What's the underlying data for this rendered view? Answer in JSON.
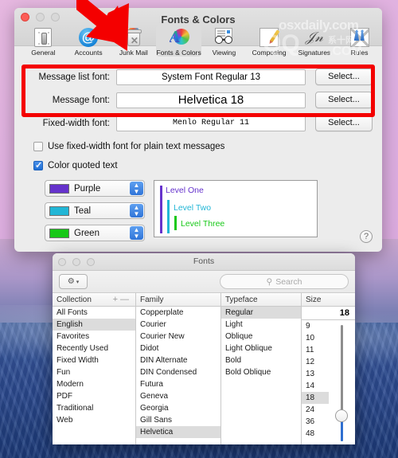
{
  "prefs_window": {
    "title": "Fonts & Colors",
    "traffic_lights": [
      "close",
      "minimize",
      "maximize"
    ],
    "toolbar": [
      {
        "label": "General",
        "icon": "general-icon",
        "selected": false
      },
      {
        "label": "Accounts",
        "icon": "accounts-at-icon",
        "selected": false
      },
      {
        "label": "Junk Mail",
        "icon": "junk-mail-trash-icon",
        "selected": false
      },
      {
        "label": "Fonts & Colors",
        "icon": "fonts-colors-icon",
        "selected": true
      },
      {
        "label": "Viewing",
        "icon": "viewing-glasses-icon",
        "selected": false
      },
      {
        "label": "Composing",
        "icon": "composing-pencil-icon",
        "selected": false
      },
      {
        "label": "Signatures",
        "icon": "signature-icon",
        "selected": false
      },
      {
        "label": "Rules",
        "icon": "rules-arrows-icon",
        "selected": false
      }
    ],
    "rows": [
      {
        "label": "Message list font:",
        "value": "System Font Regular 13",
        "button": "Select..."
      },
      {
        "label": "Message font:",
        "value": "Helvetica 18",
        "button": "Select..."
      },
      {
        "label": "Fixed-width font:",
        "value": "Menlo Regular 11",
        "button": "Select..."
      }
    ],
    "checkboxes": [
      {
        "label": "Use fixed-width font for plain text messages",
        "checked": false
      },
      {
        "label": "Color quoted text",
        "checked": true
      }
    ],
    "quote_colors": [
      {
        "name": "Purple",
        "hex": "#6633cc"
      },
      {
        "name": "Teal",
        "hex": "#22b6d6"
      },
      {
        "name": "Green",
        "hex": "#18c818"
      }
    ],
    "preview_levels": [
      {
        "label": "Level One",
        "hex": "#6633cc"
      },
      {
        "label": "Level Two",
        "hex": "#22b6d6"
      },
      {
        "label": "Level Three",
        "hex": "#18c818"
      }
    ],
    "help_label": "?"
  },
  "fonts_panel": {
    "title": "Fonts",
    "gear_label": "gear",
    "search_placeholder": "Search",
    "columns": {
      "collection": {
        "header": "Collection",
        "add_label": "+",
        "remove_label": "—",
        "items": [
          "All Fonts",
          "English",
          "Favorites",
          "Recently Used",
          "Fixed Width",
          "Fun",
          "Modern",
          "PDF",
          "Traditional",
          "Web"
        ],
        "selected": "English"
      },
      "family": {
        "header": "Family",
        "items": [
          "Copperplate",
          "Courier",
          "Courier New",
          "Didot",
          "DIN Alternate",
          "DIN Condensed",
          "Futura",
          "Geneva",
          "Georgia",
          "Gill Sans",
          "Helvetica"
        ],
        "selected": "Helvetica"
      },
      "typeface": {
        "header": "Typeface",
        "items": [
          "Regular",
          "Light",
          "Oblique",
          "Light Oblique",
          "Bold",
          "Bold Oblique"
        ],
        "selected": "Regular"
      },
      "size": {
        "header": "Size",
        "value": "18",
        "items": [
          "9",
          "10",
          "11",
          "12",
          "13",
          "14",
          "18",
          "24",
          "36",
          "48"
        ],
        "selected": "18"
      }
    }
  },
  "annotation": {
    "arrow_color": "#f40000",
    "highlight_color": "#f40000",
    "arrow_target": "fonts-colors-toolbar-item"
  },
  "watermarks": {
    "line1": "osxdaily.com",
    "line2": "QQ",
    "line3": "系十网",
    "line4": ".COM"
  }
}
